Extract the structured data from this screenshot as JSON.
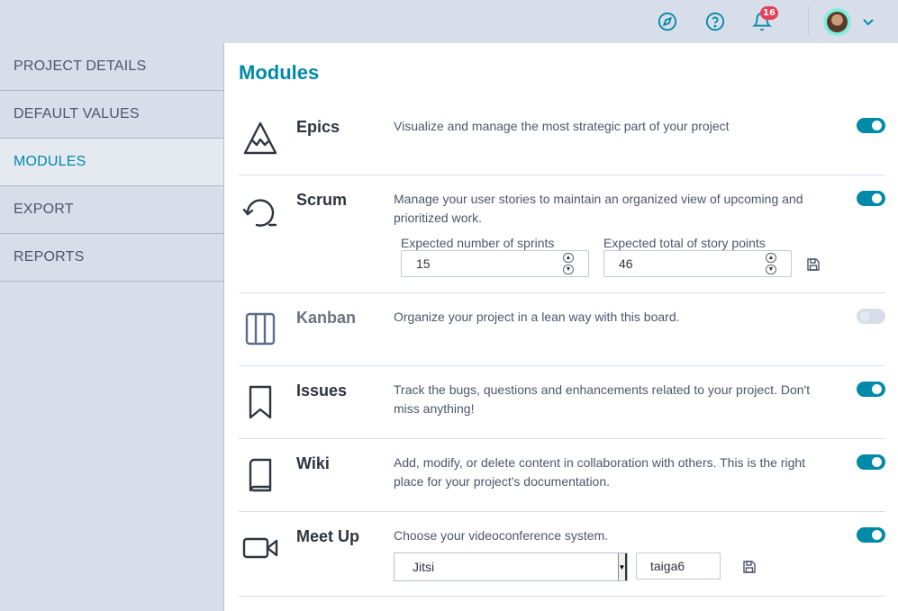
{
  "header": {
    "notifications_count": "16",
    "icons": [
      "compass-icon",
      "help-icon",
      "bell-icon",
      "avatar",
      "chevron-down-icon"
    ]
  },
  "sidebar": {
    "items": [
      {
        "label": "PROJECT DETAILS",
        "active": false
      },
      {
        "label": "DEFAULT VALUES",
        "active": false
      },
      {
        "label": "MODULES",
        "active": true
      },
      {
        "label": "EXPORT",
        "active": false
      },
      {
        "label": "REPORTS",
        "active": false
      }
    ]
  },
  "main": {
    "title": "Modules",
    "modules": [
      {
        "name": "Epics",
        "icon": "mountain-icon",
        "description": "Visualize and manage the most strategic part of your project",
        "enabled": true
      },
      {
        "name": "Scrum",
        "icon": "cycle-icon",
        "description": "Manage your user stories to maintain an organized view of upcoming and prioritized work.",
        "enabled": true,
        "sprints_label": "Expected number of sprints",
        "sprints_value": "15",
        "points_label": "Expected total of story points",
        "points_value": "46"
      },
      {
        "name": "Kanban",
        "icon": "columns-icon",
        "description": "Organize your project in a lean way with this board.",
        "enabled": false
      },
      {
        "name": "Issues",
        "icon": "bookmark-icon",
        "description": "Track the bugs, questions and enhancements related to your project. Don't miss anything!",
        "enabled": true
      },
      {
        "name": "Wiki",
        "icon": "book-icon",
        "description": "Add, modify, or delete content in collaboration with others. This is the right place for your project's documentation.",
        "enabled": true
      },
      {
        "name": "Meet Up",
        "icon": "video-icon",
        "description": "Choose your videoconference system.",
        "enabled": true,
        "system_value": "Jitsi",
        "room_value": "taiga6"
      }
    ]
  },
  "colors": {
    "accent": "#008aa8",
    "sidebar_bg": "#d8dee9",
    "badge": "#e44057"
  }
}
